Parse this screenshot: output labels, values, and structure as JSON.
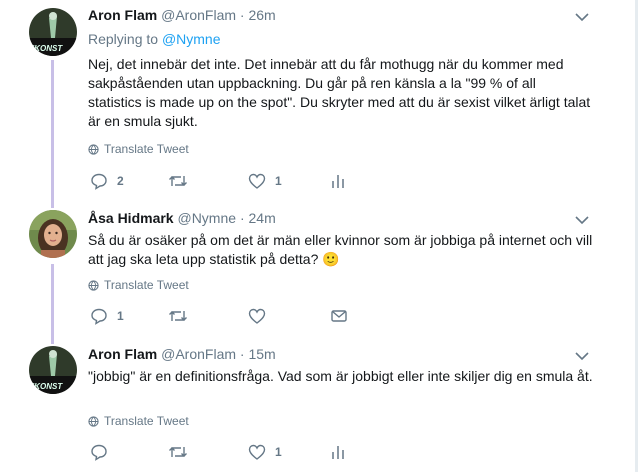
{
  "tweets": [
    {
      "name": "Aron Flam",
      "handle": "@AronFlam",
      "dot": "·",
      "time": "26m",
      "replying_label": "Replying to",
      "replying_mention": "@Nymne",
      "text": "Nej, det innebär det inte. Det innebär att du får mothugg när du kommer med sakpåståenden utan uppbackning. Du går på ren känsla a la \"99 % of all statistics is made up on the spot\". Du skryter med att du är sexist vilket ärligt talat är en smula sjukt.",
      "translate": "Translate Tweet",
      "reply_count": "2",
      "retweet_count": "",
      "like_count": "1"
    },
    {
      "name": "Åsa Hidmark",
      "handle": "@Nymne",
      "dot": "·",
      "time": "24m",
      "text": "Så du är osäker på om det är män eller kvinnor som är jobbiga på internet och vill att jag ska leta upp statistik på detta? 🙂",
      "translate": "Translate Tweet",
      "reply_count": "1",
      "retweet_count": "",
      "like_count": ""
    },
    {
      "name": "Aron Flam",
      "handle": "@AronFlam",
      "dot": "·",
      "time": "15m",
      "text": "\"jobbig\" är en definitionsfråga. Vad som är jobbigt eller inte skiljer dig en smula åt.",
      "translate": "Translate Tweet",
      "reply_count": "",
      "retweet_count": "",
      "like_count": "1"
    }
  ],
  "colors": {
    "link": "#1da1f2",
    "muted": "#657786",
    "thread": "#c8bfe7"
  }
}
